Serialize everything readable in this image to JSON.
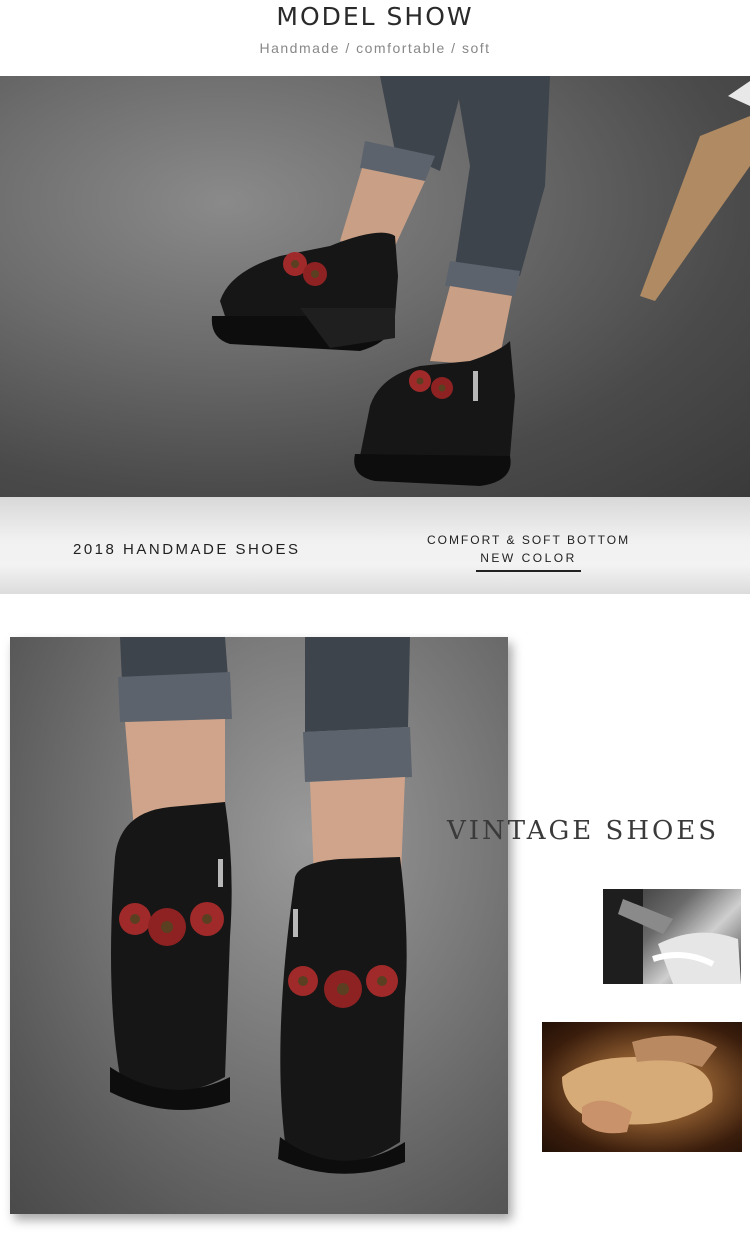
{
  "header": {
    "title": "MODEL SHOW",
    "subtitle": "Handmade / comfortable / soft"
  },
  "band": {
    "left_text": "2018 HANDMADE SHOES",
    "right_line1": "COMFORT & SOFT BOTTOM",
    "right_line2": "NEW COLOR"
  },
  "side": {
    "heading": "VINTAGE SHOES"
  },
  "colors": {
    "shoe": "#161616",
    "flower": "#a02a2a",
    "denim": "#4a4f57"
  }
}
